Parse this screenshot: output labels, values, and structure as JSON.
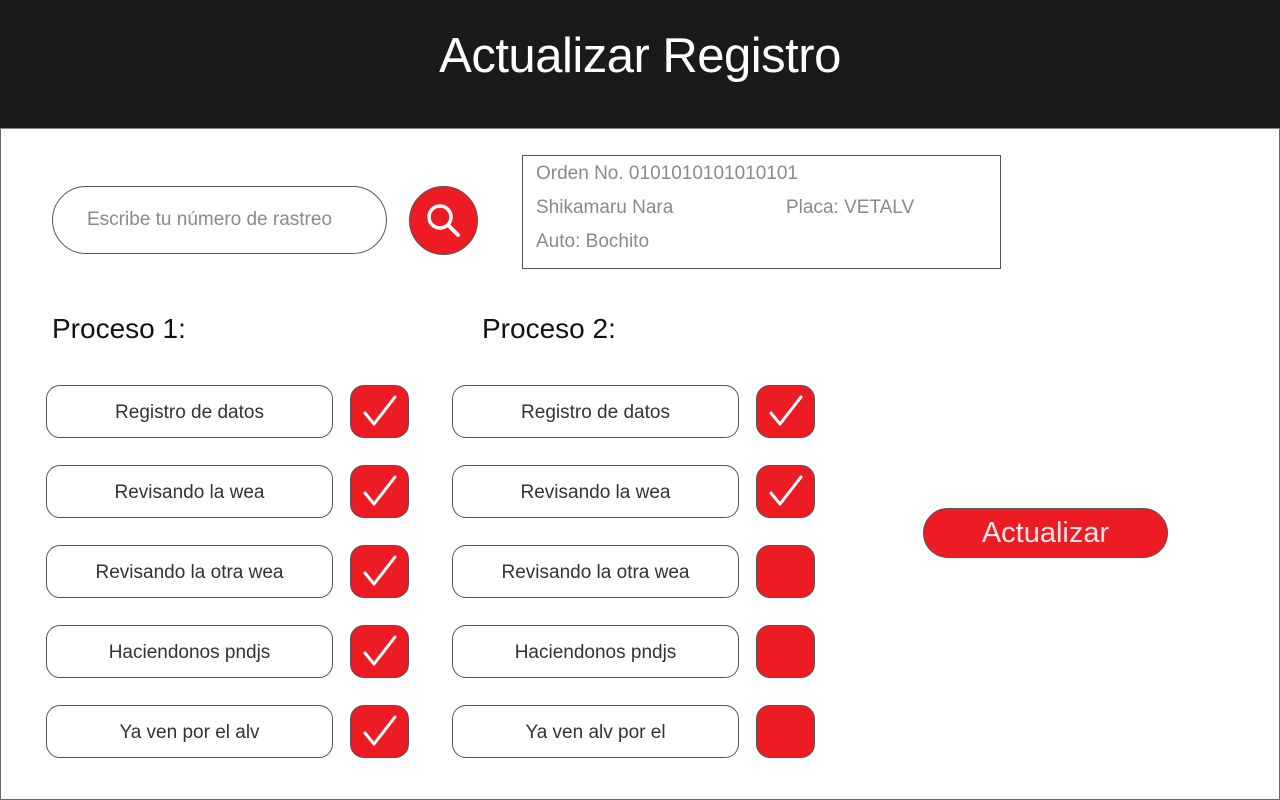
{
  "header": {
    "title": "Actualizar Registro"
  },
  "search": {
    "placeholder": "Escribe tu número de rastreo",
    "value": "",
    "icon": "search-icon"
  },
  "order": {
    "number_label": "Orden No. 0101010101010101",
    "name": "Shikamaru Nara",
    "plate_label": "Placa: VETALV",
    "car_label": "Auto: Bochito"
  },
  "proceso1": {
    "title": "Proceso 1:",
    "steps": [
      {
        "label": "Registro de datos",
        "checked": true
      },
      {
        "label": "Revisando la wea",
        "checked": true
      },
      {
        "label": "Revisando la otra wea",
        "checked": true
      },
      {
        "label": "Haciendonos pndjs",
        "checked": true
      },
      {
        "label": "Ya ven por el alv",
        "checked": true
      }
    ]
  },
  "proceso2": {
    "title": "Proceso 2:",
    "steps": [
      {
        "label": "Registro de datos",
        "checked": true
      },
      {
        "label": "Revisando la wea",
        "checked": true
      },
      {
        "label": "Revisando la otra wea",
        "checked": false
      },
      {
        "label": "Haciendonos pndjs",
        "checked": false
      },
      {
        "label": "Ya ven alv por el",
        "checked": false
      }
    ]
  },
  "actions": {
    "update_label": "Actualizar"
  },
  "colors": {
    "accent": "#ed1c24",
    "header_bg": "#1a1a1a",
    "muted_text": "#8a8a8a"
  }
}
